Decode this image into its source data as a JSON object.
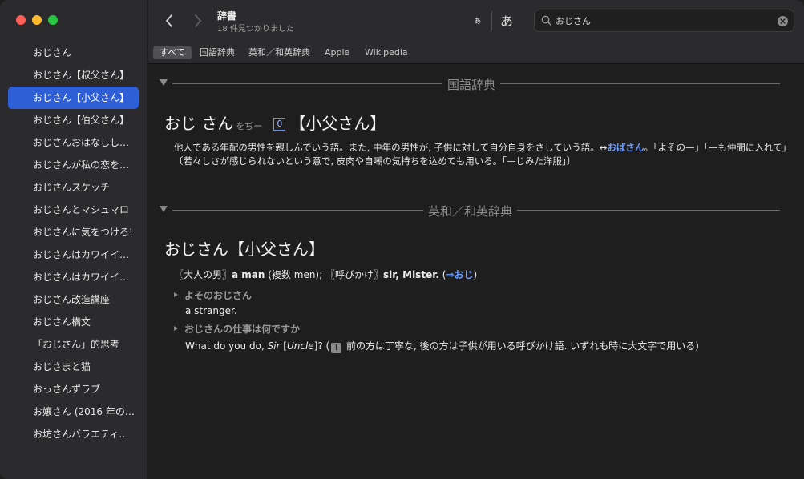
{
  "sidebar": {
    "items": [
      {
        "label": "おじさん"
      },
      {
        "label": "おじさん【叔父さん】"
      },
      {
        "label": "おじさん【小父さん】"
      },
      {
        "label": "おじさん【伯父さん】"
      },
      {
        "label": "おじさんおはなしし…"
      },
      {
        "label": "おじさんが私の恋を…"
      },
      {
        "label": "おじさんスケッチ"
      },
      {
        "label": "おじさんとマシュマロ"
      },
      {
        "label": "おじさんに気をつけろ!"
      },
      {
        "label": "おじさんはカワイイ…"
      },
      {
        "label": "おじさんはカワイイ…"
      },
      {
        "label": "おじさん改造講座"
      },
      {
        "label": "おじさん構文"
      },
      {
        "label": "「おじさん」的思考"
      },
      {
        "label": "おじさまと猫"
      },
      {
        "label": "おっさんずラブ"
      },
      {
        "label": "お嬢さん (2016 年の…"
      },
      {
        "label": "お坊さんバラエティ…"
      }
    ],
    "selected_index": 2
  },
  "toolbar": {
    "title": "辞書",
    "subtitle": "18 件見つかりました",
    "font_small": "ぁ",
    "font_large": "あ",
    "search": {
      "value": "おじさん",
      "placeholder": "検索"
    }
  },
  "tabs": [
    {
      "label": "すべて",
      "active": true
    },
    {
      "label": "国語辞典"
    },
    {
      "label": "英和／和英辞典"
    },
    {
      "label": "Apple"
    },
    {
      "label": "Wikipedia"
    }
  ],
  "sections": {
    "kokugo": {
      "header": "国語辞典",
      "headword": "おじ さん",
      "reading": "をぢー",
      "accent": "0",
      "kanji": "【小父さん】",
      "def_part1": "他人である年配の男性を親しんでいう語。また, 中年の男性が, 子供に対して自分自身をさしていう語。↔",
      "def_link": "おばさん",
      "def_part2": "。「よその—」「—も仲間に入れて」〔若々しさが感じられないという意で, 皮肉や自嘲の気持ちを込めても用いる。「—じみた洋服」〕"
    },
    "eiwa": {
      "header": "英和／和英辞典",
      "headword": "おじさん【小父さん】",
      "line1_pre": "〖大人の男〗",
      "line1_a": "a man",
      "line1_b": " (複数 men); ",
      "line1_c": "〖呼びかけ〗",
      "line1_d": "sir, Mister.",
      "line1_e": " (",
      "line1_link": "⇒おじ",
      "line1_f": ")",
      "phrase1": "よそのおじさん",
      "trans1": "a stranger.",
      "phrase2": "おじさんの仕事は何ですか",
      "trans2_a": "What do you do, ",
      "trans2_sir": "Sir",
      "trans2_b": " [",
      "trans2_uncle": "Uncle",
      "trans2_c": "]? (",
      "trans2_note_icon": "!",
      "trans2_note": " 前の方は丁寧な, 後の方は子供が用いる呼びかけ語. いずれも時に大文字で用いる)"
    }
  },
  "colors": {
    "sidebar_bg": "#2b2b2d",
    "selection": "#2f5fd6",
    "content_bg": "#1e1e1e",
    "link": "#6f9bff"
  }
}
